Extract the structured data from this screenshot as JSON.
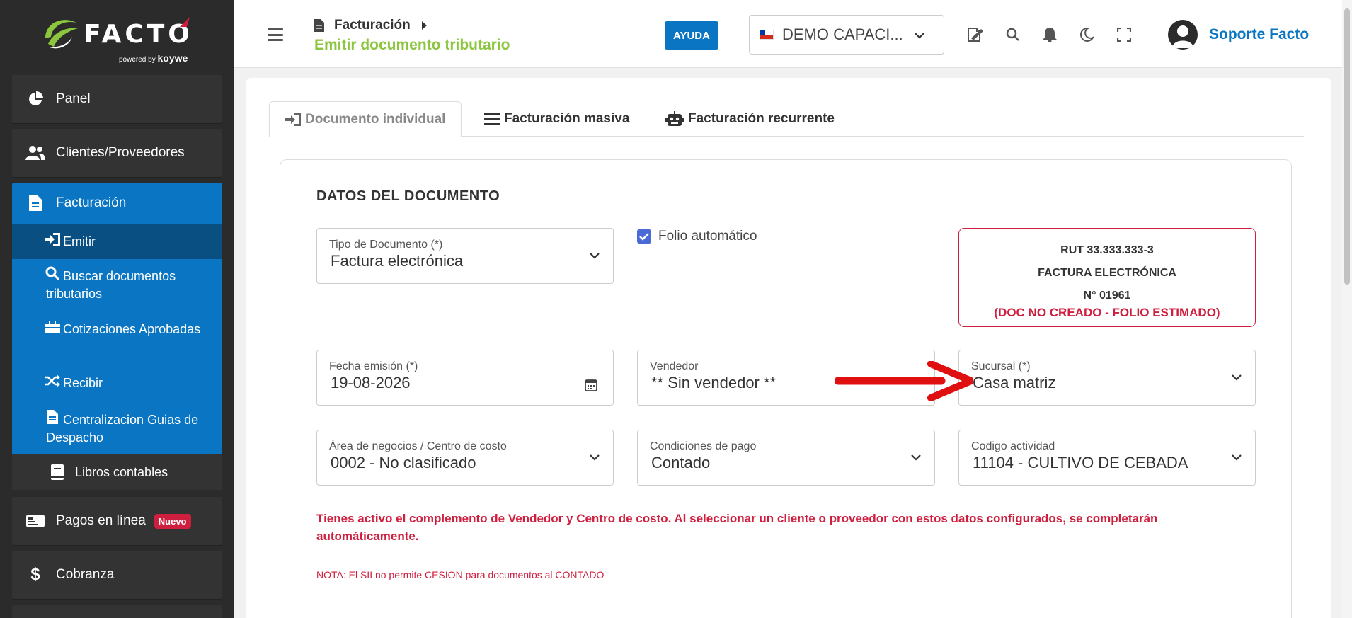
{
  "brand": {
    "logo_text": "FACTO",
    "powered": "powered",
    "by": "by",
    "partner": "koywe"
  },
  "sidebar": {
    "items": [
      {
        "label": "Panel",
        "icon": "pie-chart-icon"
      },
      {
        "label": "Clientes/Proveedores",
        "icon": "users-icon"
      },
      {
        "label": "Facturación",
        "icon": "document-icon"
      }
    ],
    "submenu": [
      {
        "label": "Emitir",
        "icon": "sign-in-icon"
      },
      {
        "label": "Buscar documentos tributarios",
        "icon": "search-icon"
      },
      {
        "label": "Cotizaciones Aprobadas",
        "icon": "briefcase-icon"
      },
      {
        "label": "Recibir",
        "icon": "shuffle-icon"
      },
      {
        "label": "Centralizacion Guias de Despacho",
        "icon": "file-icon"
      }
    ],
    "libros": "Libros contables",
    "pagos": "Pagos en línea",
    "pagos_badge": "Nuevo",
    "cobranza": "Cobranza"
  },
  "header": {
    "breadcrumb_parent": "Facturación",
    "page_title": "Emitir documento tributario",
    "help_label": "AYUDA",
    "company": "DEMO CAPACI...",
    "user_name": "Soporte Facto"
  },
  "tabs": [
    {
      "label": "Documento individual"
    },
    {
      "label": "Facturación masiva"
    },
    {
      "label": "Facturación recurrente"
    }
  ],
  "form": {
    "section_title": "DATOS DEL DOCUMENTO",
    "tipo_documento": {
      "label": "Tipo de Documento (*)",
      "value": "Factura electrónica"
    },
    "folio_auto": {
      "label": "Folio automático",
      "checked": true
    },
    "fecha": {
      "label": "Fecha emisión (*)",
      "value": "19-08-2026"
    },
    "vendedor": {
      "label": "Vendedor",
      "value": "** Sin vendedor **"
    },
    "sucursal": {
      "label": "Sucursal (*)",
      "value": "Casa matriz"
    },
    "area": {
      "label": "Área de negocios / Centro de costo",
      "value": "0002 - No clasificado"
    },
    "condiciones": {
      "label": "Condiciones de pago",
      "value": "Contado"
    },
    "actividad": {
      "label": "Codigo actividad",
      "value": "11104 - CULTIVO DE CEBADA"
    }
  },
  "doc_box": {
    "rut": "RUT 33.333.333-3",
    "tipo": "FACTURA ELECTRÓNICA",
    "numero": "N° 01961",
    "estado": "(DOC NO CREADO - FOLIO ESTIMADO)"
  },
  "notice": "Tienes activo el complemento de Vendedor y Centro de costo. Al seleccionar un cliente o proveedor con estos datos configurados, se completarán automáticamente.",
  "note": "NOTA: El SII no permite CESION para documentos al CONTADO",
  "colors": {
    "accent_blue": "#0a75c2",
    "accent_green": "#8cc63f",
    "alert_red": "#cf1f3f",
    "sidebar_bg": "#2b2b2b"
  }
}
